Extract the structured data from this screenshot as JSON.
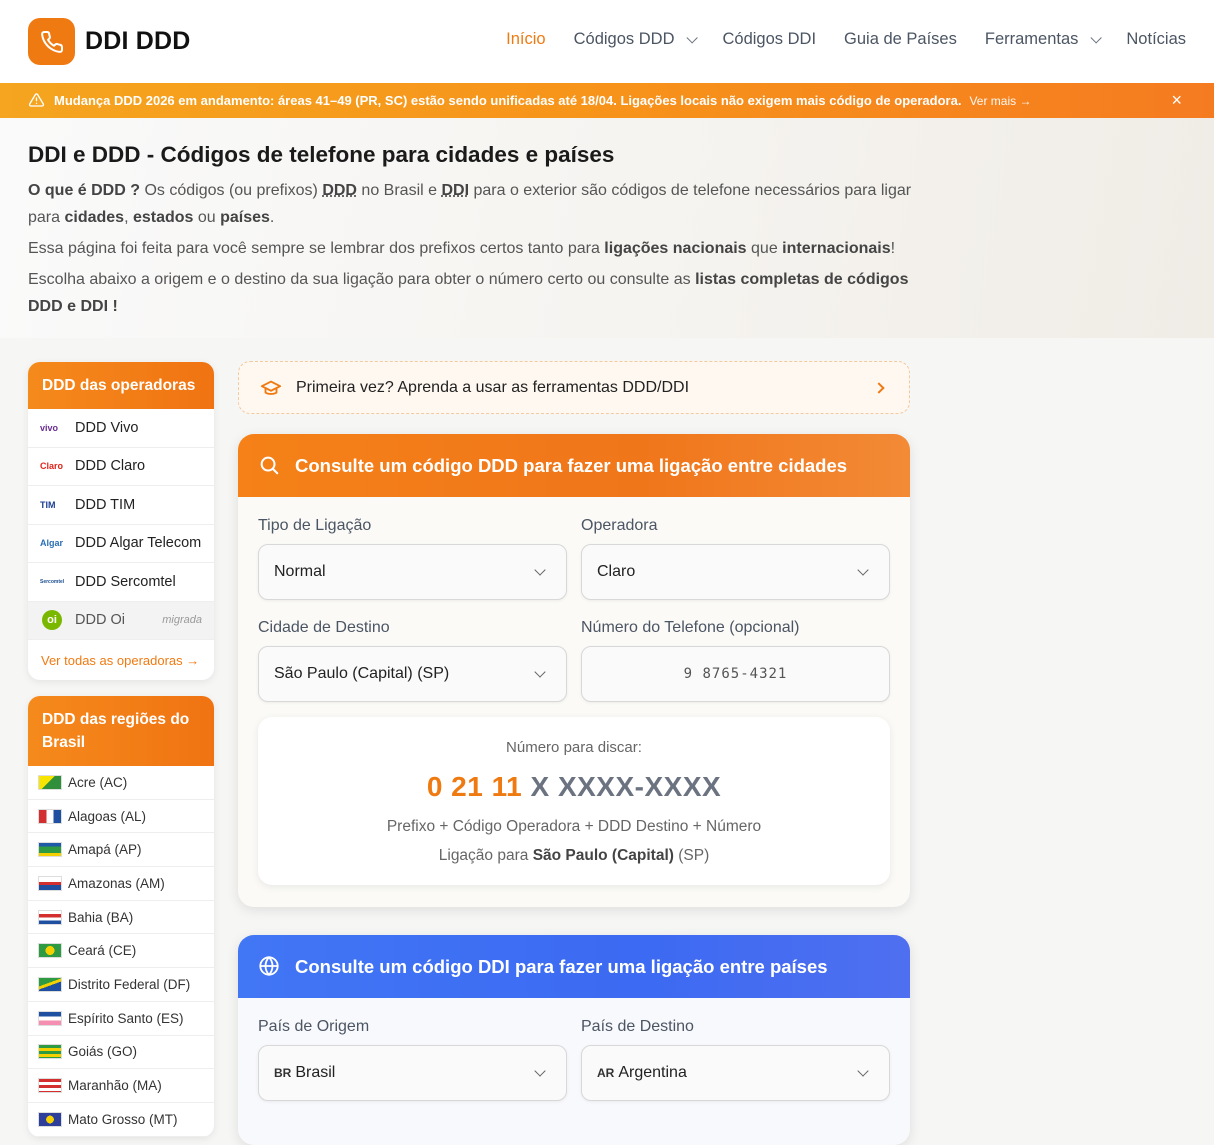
{
  "header": {
    "logo_text": "DDI DDD",
    "nav": [
      {
        "label": "Início",
        "active": true,
        "dropdown": false
      },
      {
        "label": "Códigos DDD",
        "active": false,
        "dropdown": true
      },
      {
        "label": "Códigos DDI",
        "active": false,
        "dropdown": false
      },
      {
        "label": "Guia de Países",
        "active": false,
        "dropdown": false
      },
      {
        "label": "Ferramentas",
        "active": false,
        "dropdown": true
      },
      {
        "label": "Notícias",
        "active": false,
        "dropdown": false
      }
    ]
  },
  "banner": {
    "text": "Mudança DDD 2026 em andamento: áreas 41–49 (PR, SC) estão sendo unificadas até 18/04. Ligações locais não exigem mais código de operadora.",
    "link": "Ver mais →",
    "close": "×"
  },
  "intro": {
    "title": "DDI e DDD - Códigos de telefone para cidades e países",
    "p1_q": "O que é DDD ?",
    "p1_a": " Os códigos (ou prefixos) ",
    "p1_ddd": "DDD",
    "p1_b": " no Brasil e ",
    "p1_ddi": "DDI",
    "p1_c": " para o exterior são códigos de telefone necessários para ligar para ",
    "p1_cidades": "cidades",
    "p1_sep": ", ",
    "p1_estados": "estados",
    "p1_ou": " ou ",
    "p1_paises": "países",
    "p1_end": ".",
    "p2_a": "Essa página foi feita para você sempre se lembrar dos prefixos certos tanto para ",
    "p2_nac": "ligações nacionais",
    "p2_b": " que ",
    "p2_int": "internacionais",
    "p2_end": "!",
    "p3_a": "Escolha abaixo a origem e o destino da sua ligação para obter o número certo ou consulte as ",
    "p3_b": "listas completas de códigos DDD e DDI !"
  },
  "operators": {
    "title": "DDD das operadoras",
    "items": [
      {
        "label": "DDD Vivo",
        "logo": "vivo",
        "color": "#6b2c91"
      },
      {
        "label": "DDD Claro",
        "logo": "Claro",
        "color": "#e2231a"
      },
      {
        "label": "DDD TIM",
        "logo": "TIM",
        "color": "#1c3f94"
      },
      {
        "label": "DDD Algar Telecom",
        "logo": "Algar",
        "color": "#2a6fb5"
      },
      {
        "label": "DDD Sercomtel",
        "logo": "Sercomtel",
        "color": "#1d4f91"
      },
      {
        "label": "DDD Oi",
        "logo": "oi",
        "color": "#7ab800",
        "tag": "migrada"
      }
    ],
    "see_all": "Ver todas as operadoras →"
  },
  "regions": {
    "title": "DDD das regiões do Brasil",
    "items": [
      "Acre (AC)",
      "Alagoas (AL)",
      "Amapá (AP)",
      "Amazonas (AM)",
      "Bahia (BA)",
      "Ceará (CE)",
      "Distrito Federal (DF)",
      "Espírito Santo (ES)",
      "Goiás (GO)",
      "Maranhão (MA)",
      "Mato Grosso (MT)"
    ]
  },
  "tutorial": {
    "text": "Primeira vez? Aprenda a usar as ferramentas DDD/DDI"
  },
  "ddd_panel": {
    "head_a": "Consulte um ",
    "head_b": "código DDD",
    "head_c": " para fazer uma ligação entre cidades",
    "tipo_label": "Tipo de Ligação",
    "tipo_value": "Normal",
    "operadora_label": "Operadora",
    "operadora_value": "Claro",
    "cidade_label": "Cidade de Destino",
    "cidade_value": "São Paulo (Capital) (SP)",
    "telefone_label": "Número do Telefone (opcional)",
    "telefone_placeholder": "9 8765-4321",
    "result_label": "Número para discar:",
    "result_hl": "0 21 11",
    "result_rest": " X XXXX-XXXX",
    "result_legend": "Prefixo + Código Operadora + DDD Destino + Número",
    "result_dest_a": "Ligação para ",
    "result_dest_b": "São Paulo (Capital)",
    "result_dest_c": " (SP)"
  },
  "ddi_panel": {
    "head_a": "Consulte um ",
    "head_b": "código DDI",
    "head_c": " para fazer uma ligação entre países",
    "origem_label": "País de Origem",
    "origem_code": "BR",
    "origem_value": "Brasil",
    "destino_label": "País de Destino",
    "destino_code": "AR",
    "destino_value": "Argentina"
  },
  "colors": {
    "accent": "#f07a12",
    "ddi_accent": "#3b6cf6"
  }
}
